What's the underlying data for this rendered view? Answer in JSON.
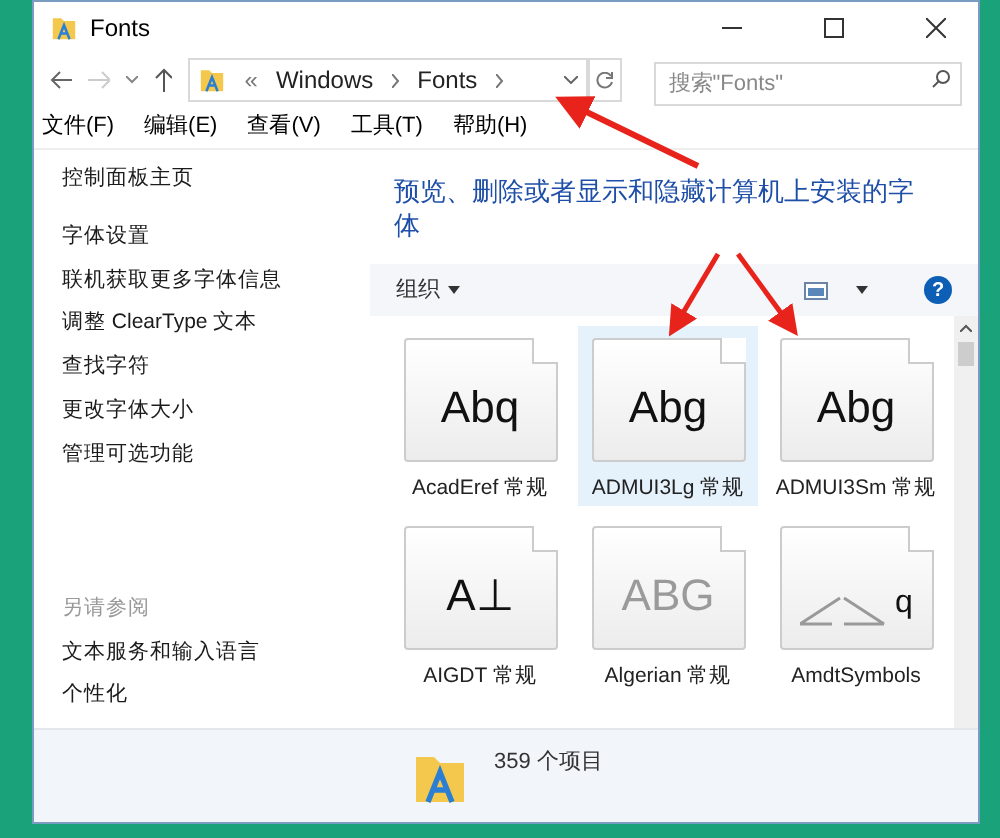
{
  "window": {
    "title": "Fonts"
  },
  "address": {
    "overflow": "«",
    "crumbs": [
      "Windows",
      "Fonts"
    ]
  },
  "search": {
    "placeholder": "搜索\"Fonts\""
  },
  "menu": [
    "文件(F)",
    "编辑(E)",
    "查看(V)",
    "工具(T)",
    "帮助(H)"
  ],
  "sidebar": {
    "home": "控制面板主页",
    "links": [
      "字体设置",
      "联机获取更多字体信息",
      "调整 ClearType 文本",
      "查找字符",
      "更改字体大小",
      "管理可选功能"
    ],
    "see_also": "另请参阅",
    "see_also_links": [
      "文本服务和输入语言",
      "个性化"
    ]
  },
  "heading": "预览、删除或者显示和隐藏计算机上安装的字体",
  "toolbar": {
    "organize": "组织",
    "help": "?"
  },
  "fonts": [
    {
      "name": "AcadEref 常规",
      "kind": "text",
      "sample": "Abq",
      "selected": false,
      "hidden": false
    },
    {
      "name": "ADMUI3Lg 常规",
      "kind": "text",
      "sample": "Abg",
      "selected": true,
      "hidden": false
    },
    {
      "name": "ADMUI3Sm 常规",
      "kind": "text",
      "sample": "Abg",
      "selected": false,
      "hidden": false
    },
    {
      "name": "AIGDT 常规",
      "kind": "text",
      "sample": "A⊥",
      "selected": false,
      "hidden": false
    },
    {
      "name": "Algerian 常规",
      "kind": "text",
      "sample": "ABG",
      "selected": false,
      "hidden": true
    },
    {
      "name": "AmdtSymbols",
      "kind": "lines",
      "sample": "q",
      "selected": false,
      "hidden": false
    }
  ],
  "status_bar": {
    "count": "359 个项目"
  }
}
